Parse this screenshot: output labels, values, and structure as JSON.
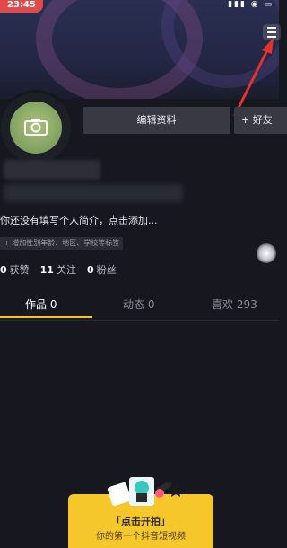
{
  "status_bar": {
    "time": "23:45",
    "icons": "▮▮▮ ◉ ▭"
  },
  "profile": {
    "edit_profile_label": "编辑资料",
    "add_friend_label": "+ 好友",
    "bio": "你还没有填写个人简介，点击添加...",
    "tag": "+ 增加性别年龄、地区、学校等标签"
  },
  "stats": [
    {
      "value": "0",
      "label": "获赞"
    },
    {
      "value": "11",
      "label": "关注"
    },
    {
      "value": "0",
      "label": "粉丝"
    }
  ],
  "tabs": [
    {
      "label": "作品 0",
      "active": true
    },
    {
      "label": "动态 0",
      "active": false
    },
    {
      "label": "喜欢 293",
      "active": false
    }
  ],
  "shoot_card": {
    "title": "「点击开拍」",
    "subtitle": "你的第一个抖音短视频"
  },
  "colors": {
    "accent": "#f5c518",
    "background": "#16171f",
    "annotation": "#e5322d"
  },
  "icons": [
    "menu-icon",
    "camera-icon",
    "annotation-arrow"
  ]
}
